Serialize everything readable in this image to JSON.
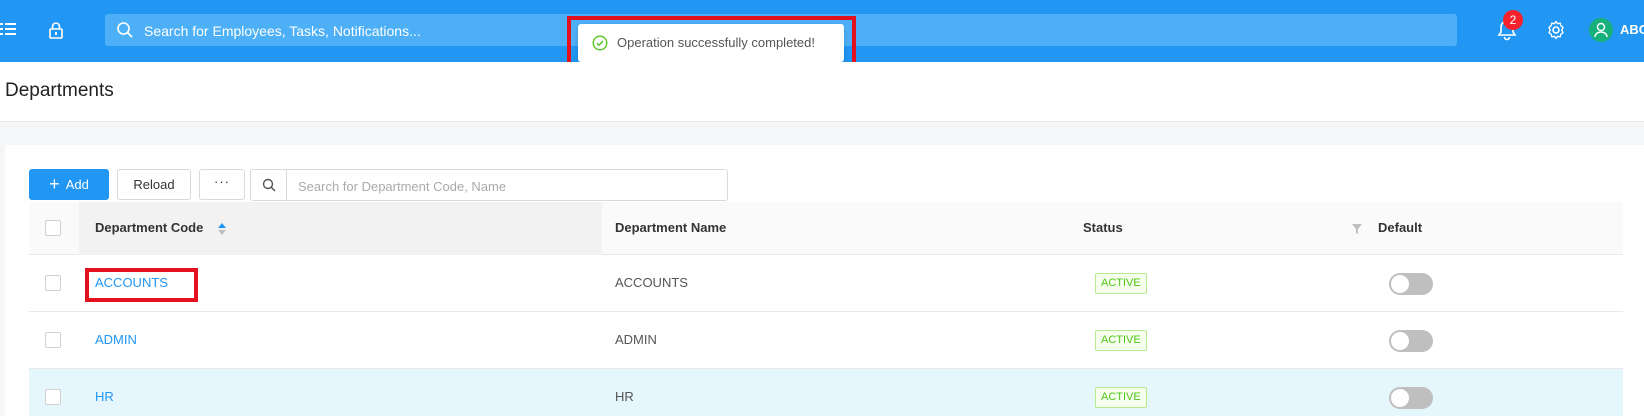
{
  "topbar": {
    "search_placeholder": "Search for Employees, Tasks, Notifications...",
    "notification_count": "2",
    "user_name": "ABC",
    "color": "#2196f3"
  },
  "toast": {
    "message": "Operation successfully completed!",
    "icon": "check-circle-icon"
  },
  "page": {
    "title": "Departments"
  },
  "toolbar": {
    "add_label": "Add",
    "reload_label": "Reload",
    "more_label": "···",
    "search_placeholder": "Search for Department Code, Name"
  },
  "table": {
    "columns": [
      "Department Code",
      "Department Name",
      "Status",
      "Default"
    ],
    "rows": [
      {
        "code": "ACCOUNTS",
        "name": "ACCOUNTS",
        "status": "ACTIVE",
        "default": false
      },
      {
        "code": "ADMIN",
        "name": "ADMIN",
        "status": "ACTIVE",
        "default": false
      },
      {
        "code": "HR",
        "name": "HR",
        "status": "ACTIVE",
        "default": false
      }
    ]
  }
}
